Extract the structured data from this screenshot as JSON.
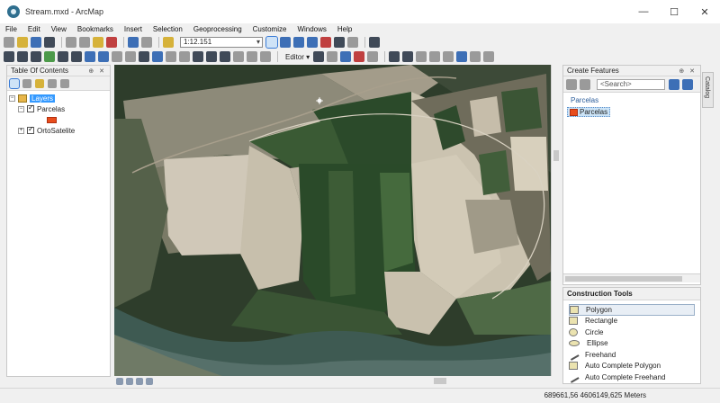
{
  "window": {
    "title": "Stream.mxd - ArcMap",
    "controls": [
      "—",
      "☐",
      "✕"
    ]
  },
  "menu": [
    "File",
    "Edit",
    "View",
    "Bookmarks",
    "Insert",
    "Selection",
    "Geoprocessing",
    "Customize",
    "Windows",
    "Help"
  ],
  "toolbar": {
    "scale_value": "1:12.151",
    "editor_label": "Editor ▾"
  },
  "toc": {
    "title": "Table Of Contents",
    "tree": {
      "root_label": "Layers",
      "layers": [
        {
          "label": "Parcelas"
        },
        {
          "label": "OrtoSatelite"
        }
      ]
    }
  },
  "create_features": {
    "title": "Create Features",
    "search_placeholder": "<Search>",
    "group_label": "Parcelas",
    "template_label": "Parcelas"
  },
  "construction_tools": {
    "title": "Construction Tools",
    "items": [
      {
        "label": "Polygon",
        "icon": "polygon-icon"
      },
      {
        "label": "Rectangle",
        "icon": "rectangle-icon"
      },
      {
        "label": "Circle",
        "icon": "circle-icon"
      },
      {
        "label": "Ellipse",
        "icon": "ellipse-icon"
      },
      {
        "label": "Freehand",
        "icon": "freehand-icon"
      },
      {
        "label": "Auto Complete Polygon",
        "icon": "autocomplete-polygon-icon"
      },
      {
        "label": "Auto Complete Freehand",
        "icon": "autocomplete-freehand-icon"
      }
    ]
  },
  "catalog_tab": "Catalog",
  "status": {
    "coordinates": "689661,56  4606149,625 Meters"
  },
  "colors": {
    "selection": "#3399ff",
    "parcel_fill": "#e84d1c",
    "river": "#3e5a52",
    "dark_field": "#2f4a2b",
    "bare_field": "#c9c0ad"
  }
}
